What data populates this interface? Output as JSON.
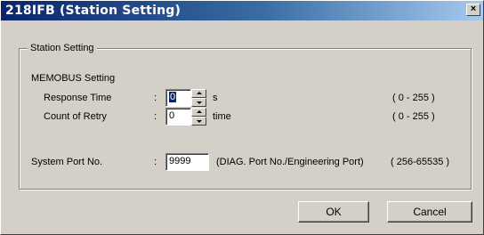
{
  "window": {
    "title": "218IFB (Station Setting)",
    "close_glyph": "×"
  },
  "group": {
    "title": "Station Setting"
  },
  "memobus": {
    "heading": "MEMOBUS Setting",
    "response_time": {
      "label": "Response Time",
      "colon": ":",
      "value": "0",
      "unit": "s",
      "range": "( 0 - 255 )"
    },
    "count_of_retry": {
      "label": "Count of Retry",
      "colon": ":",
      "value": "0",
      "unit": "time",
      "range": "( 0 - 255 )"
    }
  },
  "system_port": {
    "label": "System Port No.",
    "colon": ":",
    "value": "9999",
    "note": "(DIAG. Port No./Engineering Port)",
    "range": "( 256-65535 )"
  },
  "buttons": {
    "ok": "OK",
    "cancel": "Cancel"
  }
}
